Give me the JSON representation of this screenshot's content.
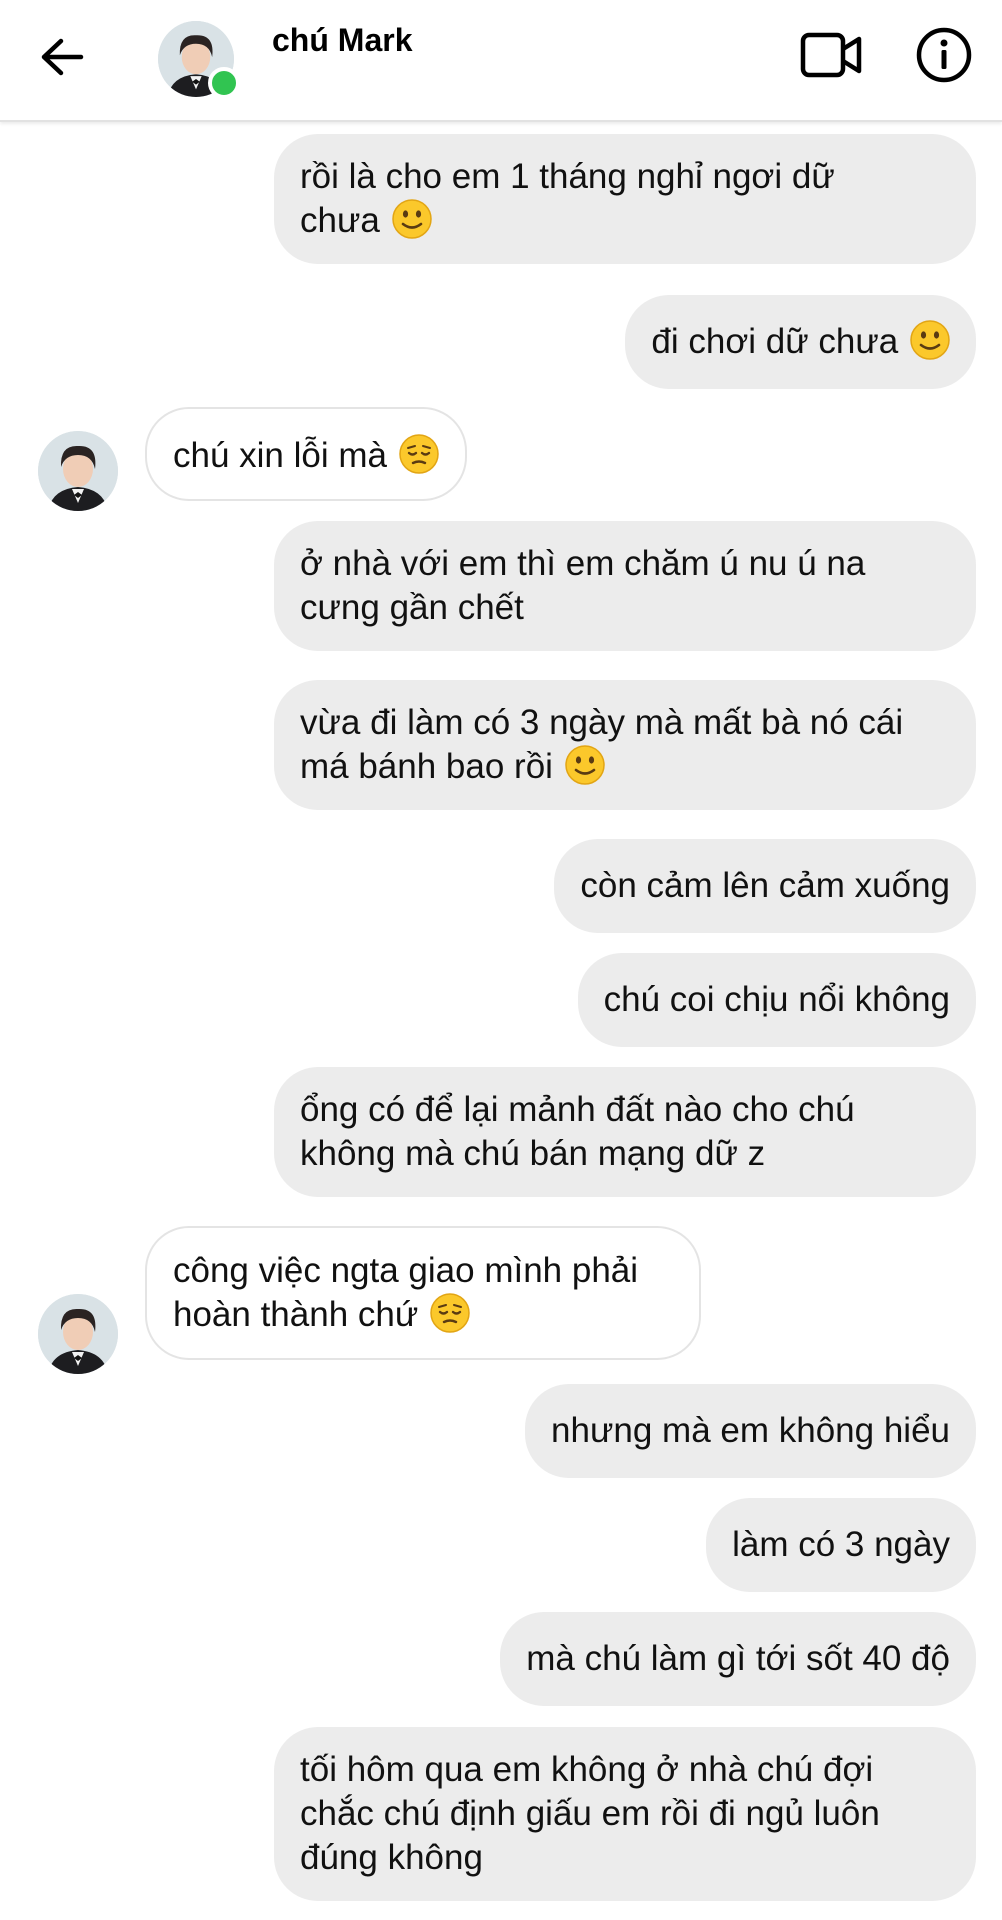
{
  "header": {
    "contact_name": "chú Mark",
    "back_icon": "arrow-left-icon",
    "video_icon": "video-camera-icon",
    "info_icon": "info-icon",
    "online_color": "#31c451"
  },
  "colors": {
    "outgoing_bubble": "#ececec",
    "incoming_bubble": "#ffffff",
    "incoming_border": "#e4e4e4"
  },
  "messages": [
    {
      "direction": "outgoing",
      "lines": [
        "rồi là cho em 1 tháng nghỉ ngơi dữ",
        "chưa"
      ],
      "emoji": "slightly-smiling-face"
    },
    {
      "direction": "outgoing",
      "lines": [
        "đi chơi dữ chưa"
      ],
      "emoji": "slightly-smiling-face"
    },
    {
      "direction": "incoming",
      "lines": [
        "chú xin lỗi mà"
      ],
      "emoji": "pensive-face"
    },
    {
      "direction": "outgoing",
      "lines": [
        "ở nhà với em thì em chăm ú nu ú na",
        "cưng gần chết"
      ],
      "emoji": null
    },
    {
      "direction": "outgoing",
      "lines": [
        "vừa đi làm có 3 ngày mà mất bà nó cái",
        "má bánh bao rồi"
      ],
      "emoji": "slightly-smiling-face"
    },
    {
      "direction": "outgoing",
      "lines": [
        "còn cảm lên cảm xuống"
      ],
      "emoji": null
    },
    {
      "direction": "outgoing",
      "lines": [
        "chú coi chịu nổi không"
      ],
      "emoji": null
    },
    {
      "direction": "outgoing",
      "lines": [
        "ổng có để lại mảnh đất nào cho chú",
        "không mà chú bán mạng dữ z"
      ],
      "emoji": null
    },
    {
      "direction": "incoming",
      "lines": [
        "công việc ngta giao mình phải",
        "hoàn thành chứ"
      ],
      "emoji": "pensive-face"
    },
    {
      "direction": "outgoing",
      "lines": [
        "nhưng mà em không hiểu"
      ],
      "emoji": null
    },
    {
      "direction": "outgoing",
      "lines": [
        "làm có 3 ngày"
      ],
      "emoji": null
    },
    {
      "direction": "outgoing",
      "lines": [
        "mà chú làm gì tới sốt 40 độ"
      ],
      "emoji": null
    },
    {
      "direction": "outgoing",
      "lines": [
        "tối hôm qua em không ở nhà chú đợi",
        "chắc chú định giấu em rồi đi ngủ luôn",
        "đúng không"
      ],
      "emoji": null
    }
  ]
}
